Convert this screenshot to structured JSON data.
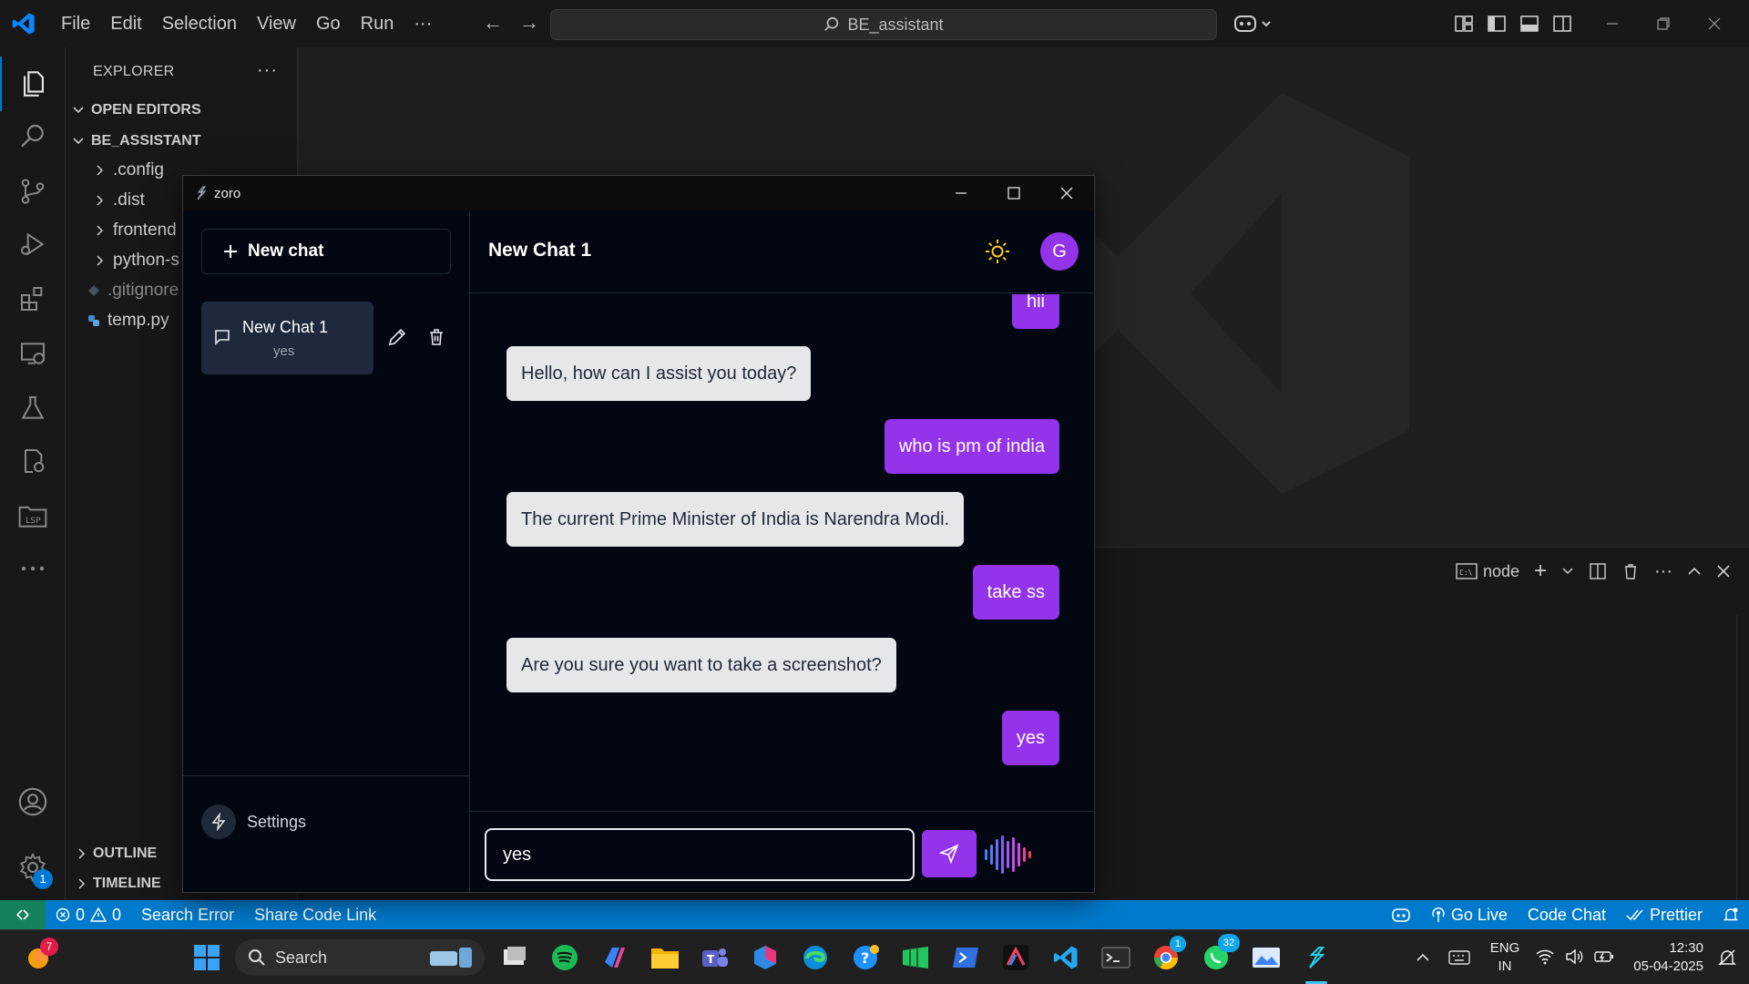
{
  "vscode": {
    "menu": [
      "File",
      "Edit",
      "Selection",
      "View",
      "Go",
      "Run",
      "···"
    ],
    "search_text": "BE_assistant",
    "explorer": {
      "header": "EXPLORER",
      "open_editors": "OPEN EDITORS",
      "project": "BE_ASSISTANT",
      "items": [
        ".config",
        ".dist",
        "frontend",
        "python-s",
        ".gitignore",
        "temp.py"
      ],
      "outline": "OUTLINE",
      "timeline": "TIMELINE"
    },
    "settings_badge": "1",
    "panel": {
      "terminal_name": "node"
    },
    "statusbar": {
      "errors": "0",
      "warnings": "0",
      "search_error": "Search Error",
      "share_code": "Share Code Link",
      "go_live": "Go Live",
      "code_chat": "Code Chat",
      "prettier": "Prettier"
    }
  },
  "taskbar": {
    "search_label": "Search",
    "start_badge": "7",
    "teams_badge": "1",
    "whatsapp_badge": "32",
    "lang_top": "ENG",
    "lang_bottom": "IN",
    "time": "12:30",
    "date": "05-04-2025"
  },
  "zoro": {
    "window_title": "zoro",
    "new_chat_label": "New chat",
    "chat_item": {
      "title": "New Chat 1",
      "preview": "yes"
    },
    "settings_label": "Settings",
    "header_title": "New Chat 1",
    "avatar_letter": "G",
    "messages": [
      {
        "role": "user",
        "text": "hii"
      },
      {
        "role": "bot",
        "text": "Hello, how can I assist you today?"
      },
      {
        "role": "user",
        "text": "who is pm of india"
      },
      {
        "role": "bot",
        "text": "The current Prime Minister of India is Narendra Modi."
      },
      {
        "role": "user",
        "text": "take ss"
      },
      {
        "role": "bot",
        "text": "Are you sure you want to take a screenshot?"
      },
      {
        "role": "user",
        "text": "yes"
      }
    ],
    "input_value": "yes"
  },
  "colors": {
    "accent_purple": "#9333ea",
    "status_blue": "#007acc",
    "vscode_blue": "#0078d4",
    "bot_bubble": "#e5e7eb"
  }
}
